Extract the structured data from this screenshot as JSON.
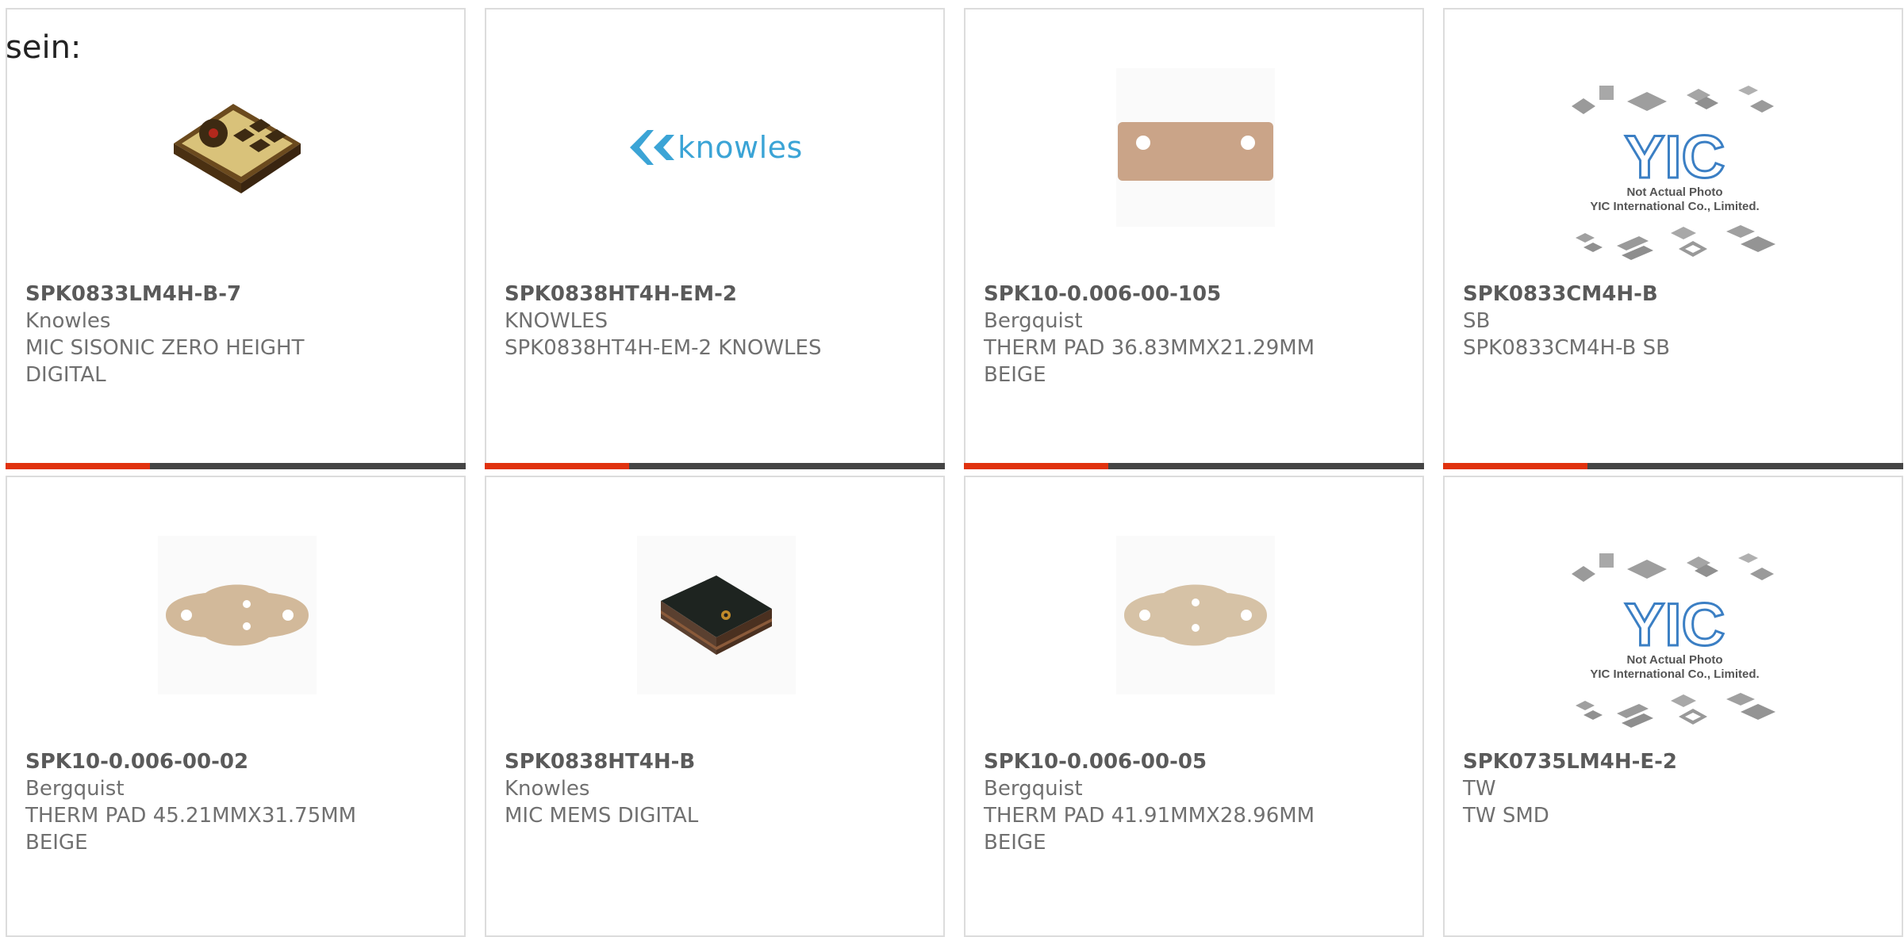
{
  "intro_text": "sein:",
  "products": [
    {
      "part": "SPK0833LM4H-B-7",
      "maker": "Knowles",
      "desc": [
        "MIC SISONIC ZERO HEIGHT",
        "DIGITAL"
      ],
      "image": "microphone-gold-icon"
    },
    {
      "part": "SPK0838HT4H-EM-2",
      "maker": "KNOWLES",
      "desc": [
        "SPK0838HT4H-EM-2 KNOWLES"
      ],
      "image": "knowles-logo",
      "logo_text": "knowles"
    },
    {
      "part": "SPK10-0.006-00-105",
      "maker": "Bergquist",
      "desc": [
        "THERM PAD 36.83MMX21.29MM",
        "BEIGE"
      ],
      "image": "therm-pad-rect-icon"
    },
    {
      "part": "SPK0833CM4H-B",
      "maker": "SB",
      "desc": [
        "SPK0833CM4H-B SB"
      ],
      "image": "yic-placeholder",
      "placeholder_lines": [
        "Not Actual Photo",
        "YIC International Co., Limited."
      ]
    },
    {
      "part": "SPK10-0.006-00-02",
      "maker": "Bergquist",
      "desc": [
        "THERM PAD 45.21MMX31.75MM",
        "BEIGE"
      ],
      "image": "therm-pad-to3-icon"
    },
    {
      "part": "SPK0838HT4H-B",
      "maker": "Knowles",
      "desc": [
        "MIC MEMS DIGITAL"
      ],
      "image": "microphone-black-icon"
    },
    {
      "part": "SPK10-0.006-00-05",
      "maker": "Bergquist",
      "desc": [
        "THERM PAD 41.91MMX28.96MM",
        "BEIGE"
      ],
      "image": "therm-pad-to3-icon"
    },
    {
      "part": "SPK0735LM4H-E-2",
      "maker": "TW",
      "desc": [
        "TW SMD"
      ],
      "image": "yic-placeholder",
      "placeholder_lines": [
        "Not Actual Photo",
        "YIC International Co., Limited."
      ]
    }
  ],
  "colors": {
    "accent": "#e0320e",
    "bar": "#454545",
    "border": "#dcdcdc",
    "logo": "#3ba4d6"
  }
}
